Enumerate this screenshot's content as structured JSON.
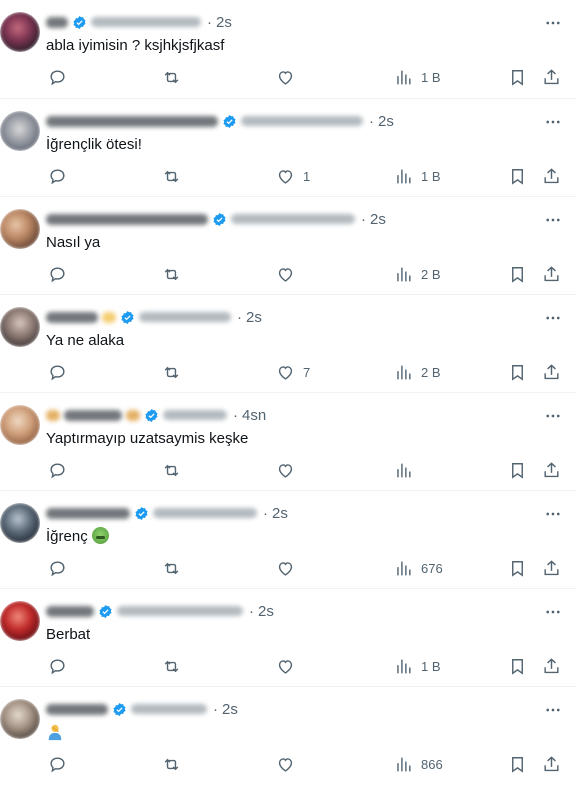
{
  "icons": {
    "reply": "reply-icon",
    "retweet": "retweet-icon",
    "like": "heart-icon",
    "views": "views-icon",
    "bookmark": "bookmark-icon",
    "share": "share-icon",
    "more": "more-dots-icon",
    "verified": "verified-badge-icon"
  },
  "colors": {
    "text": "#0f1419",
    "muted": "#536471",
    "verified": "#1d9bf0",
    "divider": "#eff3f4"
  },
  "posts": [
    {
      "time": "2s",
      "text": "abla iyimisin ? ksjhkjsfjkasf",
      "likes": "",
      "views": "1 B"
    },
    {
      "time": "2s",
      "text": "İğrençlik ötesi!",
      "likes": "1",
      "views": "1 B"
    },
    {
      "time": "2s",
      "text": "Nasıl ya",
      "likes": "",
      "views": "2 B"
    },
    {
      "time": "2s",
      "text": "Ya ne alaka",
      "likes": "7",
      "views": "2 B"
    },
    {
      "time": "4sn",
      "text": "Yaptırmayıp uzatsaymis keşke",
      "likes": "",
      "views": ""
    },
    {
      "time": "2s",
      "text": "İğrenç",
      "likes": "",
      "views": "676"
    },
    {
      "time": "2s",
      "text": "Berbat",
      "likes": "",
      "views": "1 B"
    },
    {
      "time": "2s",
      "text": "",
      "likes": "",
      "views": "866"
    }
  ]
}
